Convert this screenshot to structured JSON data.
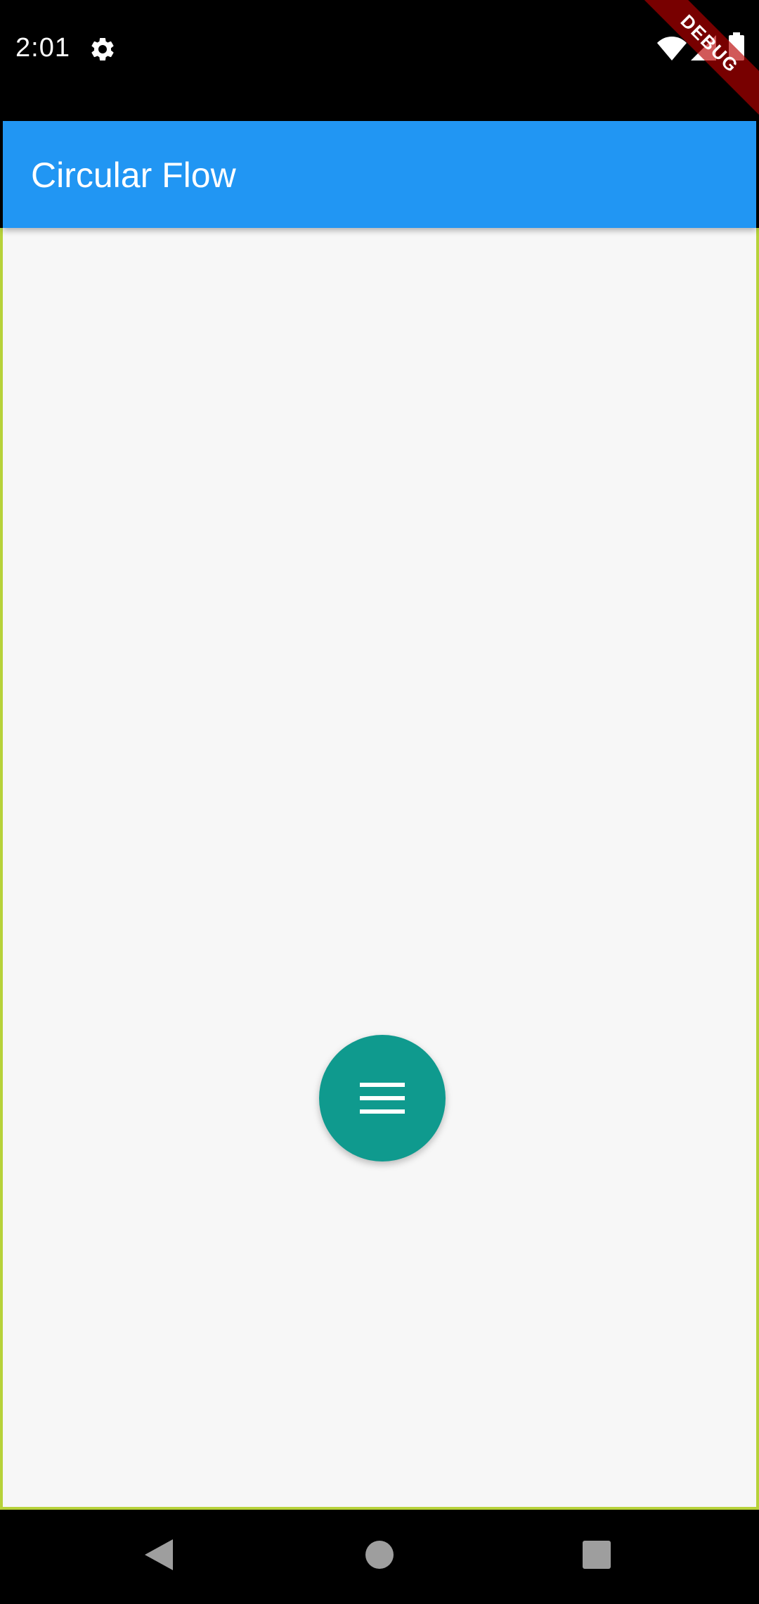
{
  "status_bar": {
    "time": "2:01",
    "icons": [
      "gear-icon",
      "wifi-icon",
      "signal-icon",
      "battery-icon"
    ]
  },
  "debug_banner": {
    "label": "DEBUG"
  },
  "app_bar": {
    "title": "Circular Flow",
    "color": "#2196f3"
  },
  "fab": {
    "icon": "menu-icon",
    "color": "#0f9a8e"
  },
  "nav_bar": {
    "icons": [
      "back-icon",
      "home-icon",
      "recents-icon"
    ]
  }
}
